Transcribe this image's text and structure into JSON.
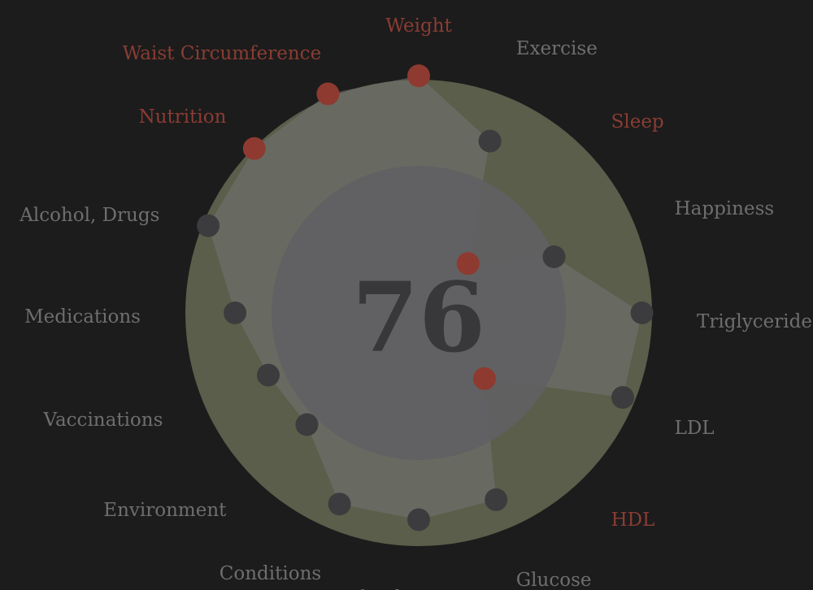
{
  "score": "76",
  "colors": {
    "background": "#1c1c1c",
    "outer_ring": "#5a5e4a",
    "inner_disc": "#616163",
    "polygon": "#747476",
    "point_normal": "#3c3c3e",
    "point_alert": "#8e3a30",
    "label_normal": "#6e6e6e",
    "label_alert": "#8a3c33",
    "score_text": "#38383a"
  },
  "chart_data": {
    "type": "radar",
    "title": "",
    "score": 76,
    "range": [
      0,
      100
    ],
    "grid": false,
    "categories": [
      "Weight",
      "Exercise",
      "Sleep",
      "Happiness",
      "Triglycerides",
      "LDL",
      "HDL",
      "Glucose",
      "Blood Pressure",
      "Conditions",
      "Environment",
      "Vaccinations",
      "Medications",
      "Alcohol, Drugs",
      "Nutrition",
      "Waist Circumference"
    ],
    "values": [
      102,
      80,
      30,
      63,
      96,
      95,
      40,
      87,
      89,
      89,
      68,
      70,
      79,
      98,
      100,
      102
    ],
    "flagged": [
      true,
      false,
      true,
      false,
      false,
      false,
      true,
      false,
      false,
      false,
      false,
      false,
      false,
      false,
      true,
      true
    ]
  }
}
